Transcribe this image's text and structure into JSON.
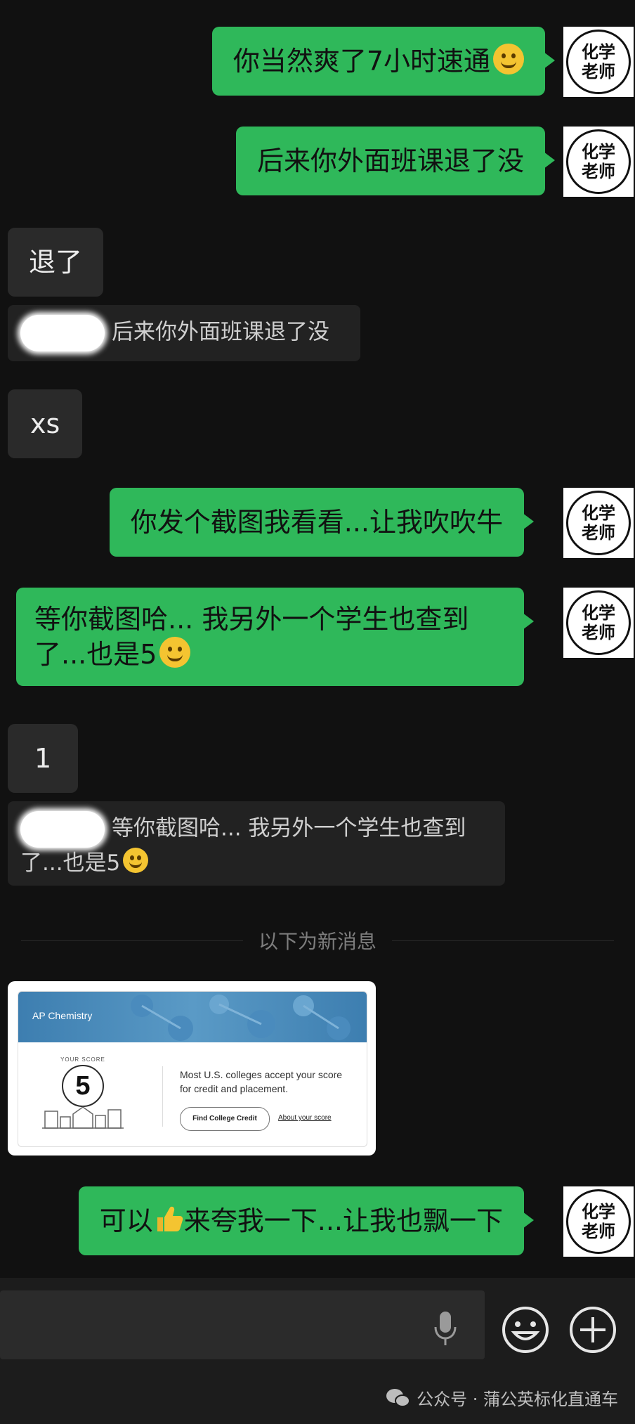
{
  "teacher": {
    "avatar_line1": "化学",
    "avatar_line2": "老师"
  },
  "messages": {
    "m1": "你当然爽了7小时速通",
    "m2": "后来你外面班课退了没",
    "m3": "退了",
    "m3_quote": "后来你外面班课退了没",
    "m4": "xs",
    "m5": "你发个截图我看看...让我吹吹牛",
    "m6_line1": "等你截图哈... 我另外一个学生也查到",
    "m6_line2": "了...也是5",
    "m7": "1",
    "m7_quote_line1": "等你截图哈... 我另外一个学生也查到",
    "m7_quote_line2": "了...也是5",
    "m8_a": "可以",
    "m8_b": "来夸我一下...让我也飘一下"
  },
  "divider": "以下为新消息",
  "score_card": {
    "subject": "AP Chemistry",
    "your_score_label": "YOUR SCORE",
    "score": "5",
    "text": "Most U.S. colleges accept your score for credit and placement.",
    "button": "Find College Credit",
    "link": "About your score"
  },
  "watermark": "公众号 · 蒲公英标化直通车",
  "colors": {
    "outgoing": "#2fb85a",
    "incoming": "#2a2a2a",
    "background": "#111111"
  }
}
